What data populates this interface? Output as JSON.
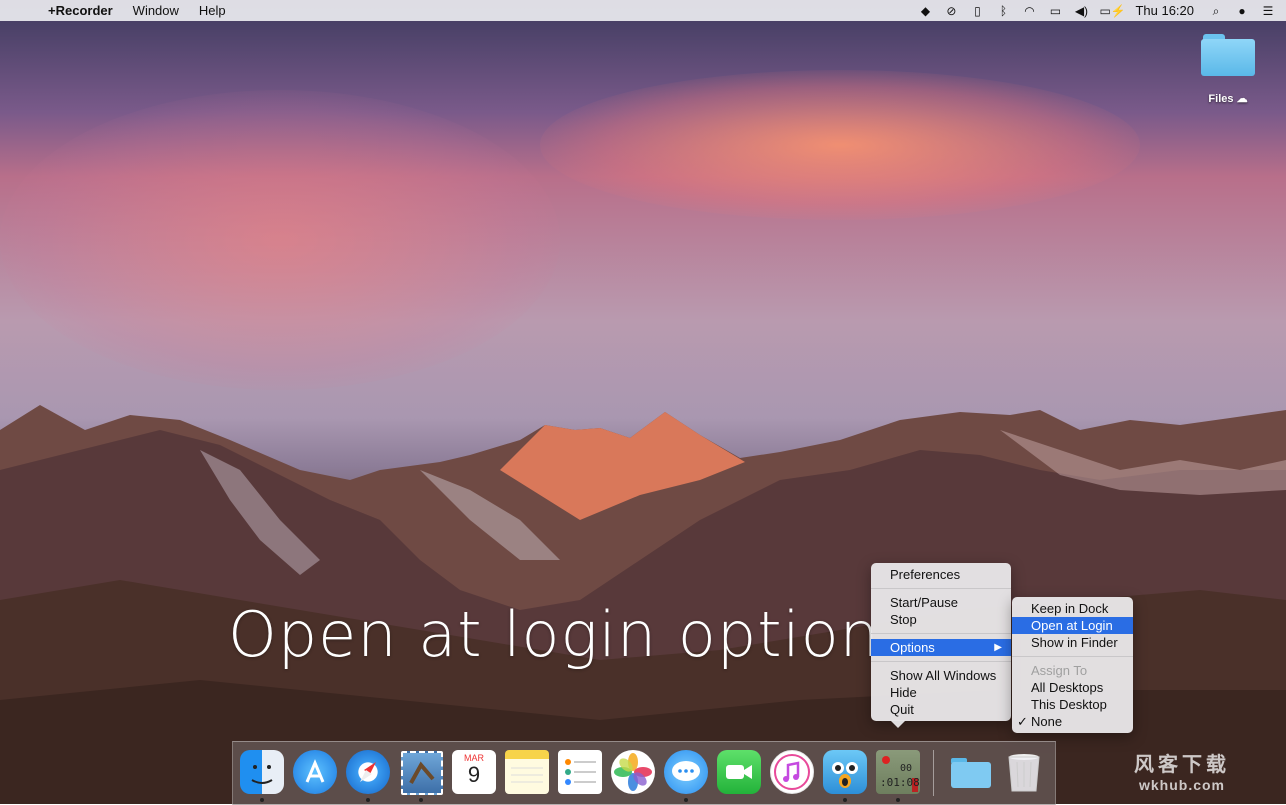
{
  "menubar": {
    "app_name": "+Recorder",
    "menus": [
      "Window",
      "Help"
    ],
    "clock": "Thu 16:20",
    "status_icons": [
      "dropbox-icon",
      "sync-icon",
      "clipboard-icon",
      "bluetooth-icon",
      "wifi-icon",
      "airplay-icon",
      "volume-icon",
      "battery-icon",
      "search-icon",
      "siri-icon",
      "notification-center-icon"
    ]
  },
  "desktop": {
    "files_label": "Files"
  },
  "overlay_caption": "Open at login option",
  "context_menu": {
    "preferences": "Preferences",
    "start_pause": "Start/Pause",
    "stop": "Stop",
    "options": "Options",
    "show_all_windows": "Show All Windows",
    "hide": "Hide",
    "quit": "Quit"
  },
  "options_submenu": {
    "keep_in_dock": "Keep in Dock",
    "open_at_login": "Open at Login",
    "show_in_finder": "Show in Finder",
    "assign_to": "Assign To",
    "all_desktops": "All Desktops",
    "this_desktop": "This Desktop",
    "none": "None",
    "checkmark": "✓"
  },
  "dock": {
    "apps": [
      "Finder",
      "App Store",
      "Safari",
      "Mail",
      "Calendar",
      "Notes",
      "Reminders",
      "Photos",
      "Messages",
      "FaceTime",
      "iTunes",
      "Tweetbot",
      "+Recorder"
    ],
    "calendar_month": "MAR",
    "calendar_day": "9",
    "recorder_time_top": "00",
    "recorder_time_bottom": ":01:08"
  },
  "watermark": {
    "line1": "风客下载",
    "line2": "wkhub.com"
  },
  "colors": {
    "menu_highlight": "#2a6de4",
    "folder_blue": "#5ab8e8"
  }
}
